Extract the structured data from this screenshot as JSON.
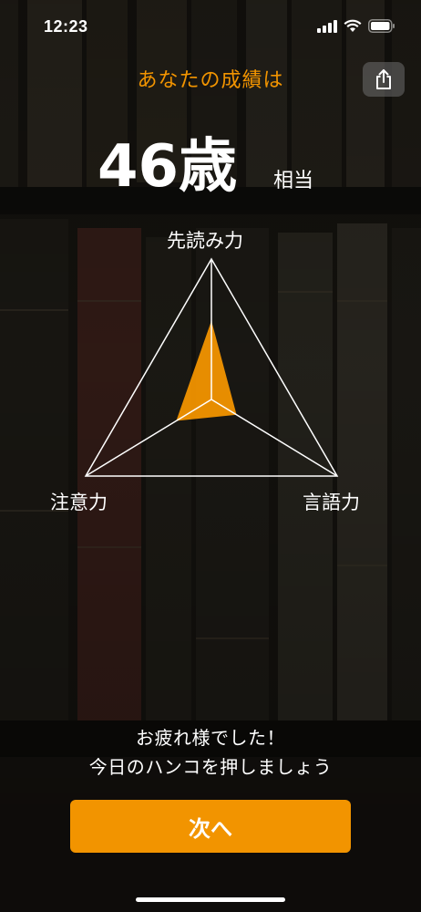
{
  "status_bar": {
    "time": "12:23",
    "icons": [
      "cellular-signal-icon",
      "wifi-icon",
      "battery-icon"
    ]
  },
  "header": {
    "title": "あなたの成績は",
    "share_icon": "share-icon"
  },
  "result": {
    "age": "46歳",
    "suffix": "相当"
  },
  "radar": {
    "axes": [
      {
        "label": "先読み力",
        "value": 0.56
      },
      {
        "label": "言語力",
        "value": 0.2
      },
      {
        "label": "注意力",
        "value": 0.28
      }
    ]
  },
  "message": {
    "line1": "お疲れ様でした！",
    "line2": "今日のハンコを押しましょう"
  },
  "next_button": {
    "label": "次へ"
  },
  "colors": {
    "accent": "#f29400",
    "background": "#121212",
    "text": "#ffffff"
  }
}
